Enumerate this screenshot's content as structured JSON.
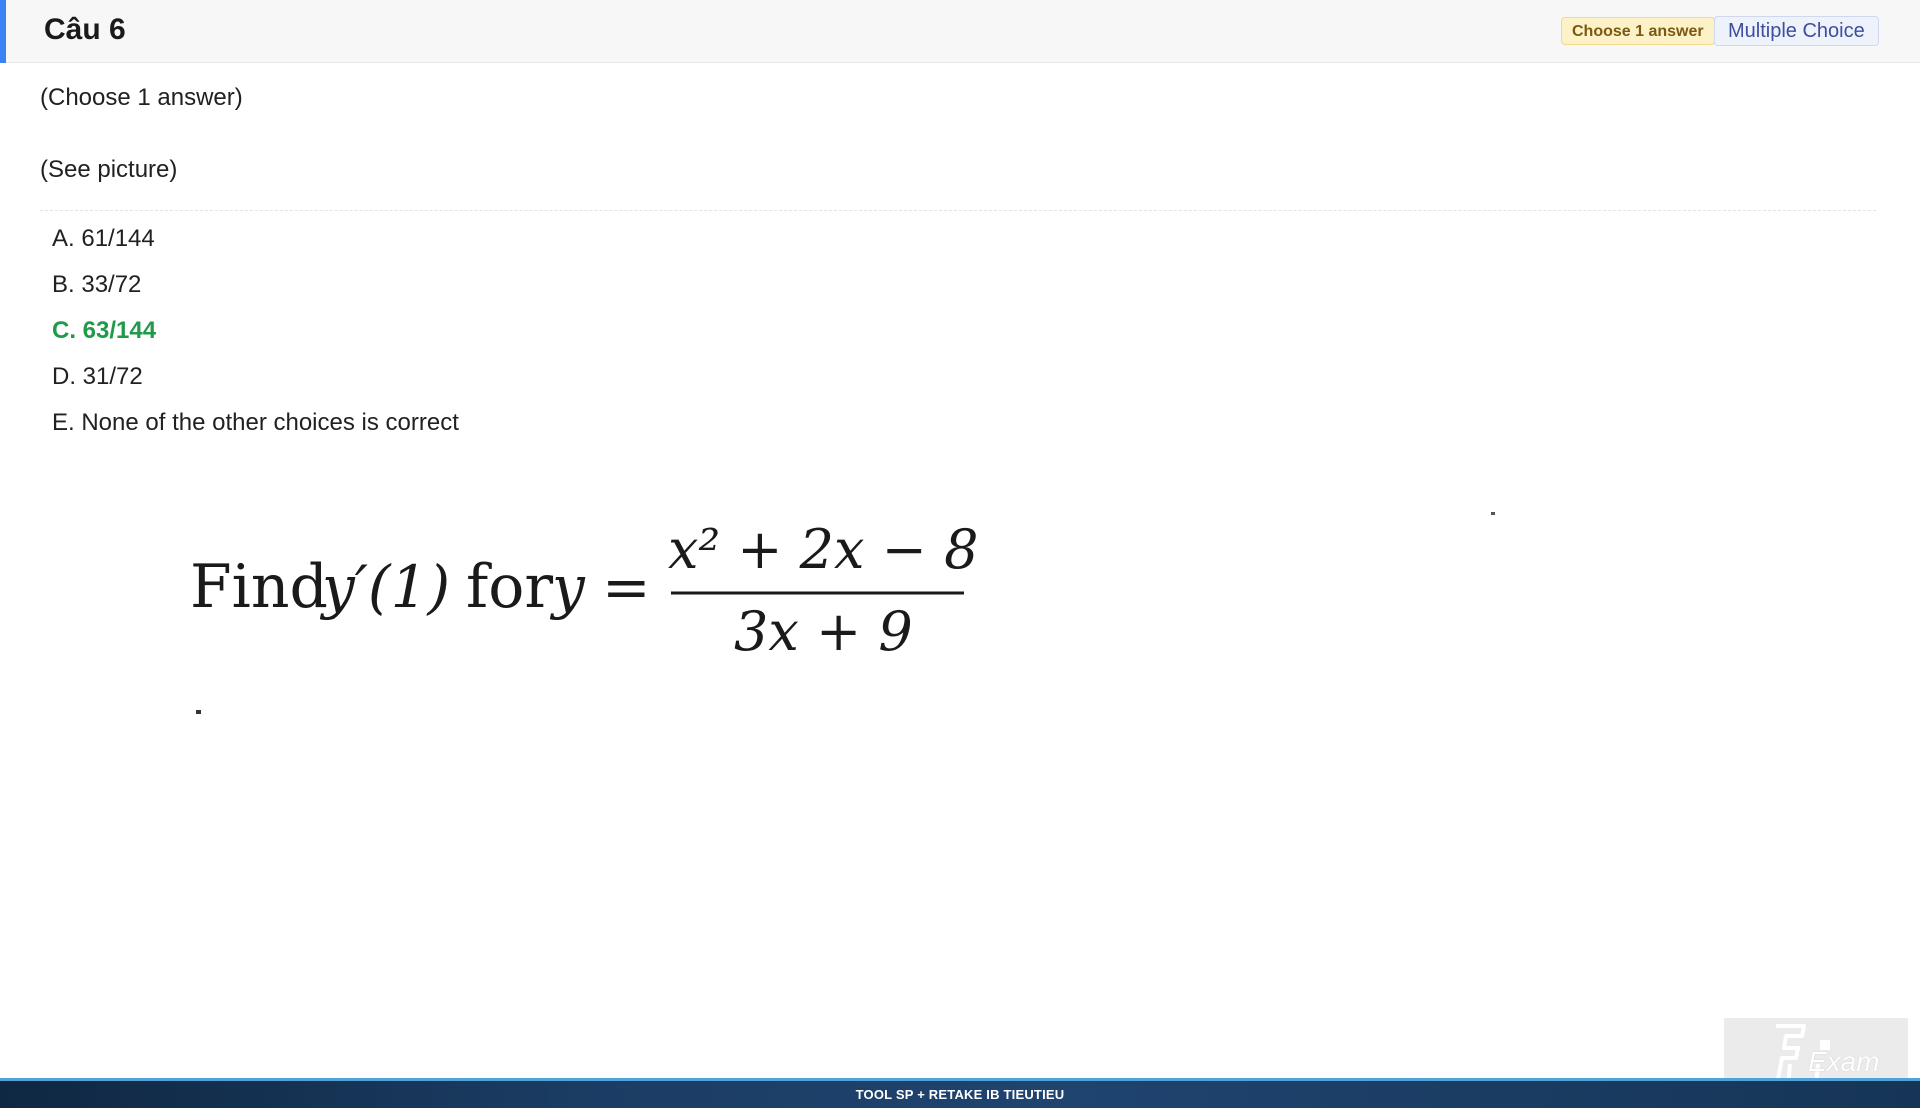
{
  "header": {
    "title": "Câu 6",
    "badge_choose": "Choose 1 answer",
    "badge_type": "Multiple Choice"
  },
  "question": {
    "instruction": "(Choose 1 answer)",
    "body": "(See picture)"
  },
  "answers": [
    {
      "label": "A. 61/144",
      "correct": false
    },
    {
      "label": "B. 33/72",
      "correct": false
    },
    {
      "label": "C. 63/144",
      "correct": true
    },
    {
      "label": "D. 31/72",
      "correct": false
    },
    {
      "label": "E. None of the other choices is correct",
      "correct": false
    }
  ],
  "picture": {
    "prefix": "Find",
    "func": "y′(1)",
    "for_text": "for",
    "var": "y",
    "eq": "=",
    "numerator": "x² + 2x − 8",
    "denominator": "3x + 9"
  },
  "footer": {
    "text": "TOOL SP + RETAKE IB TIEUTIEU"
  },
  "logo": {
    "text": "Exam"
  },
  "colors": {
    "accent": "#3b82f6",
    "correct": "#1e9a4a"
  }
}
